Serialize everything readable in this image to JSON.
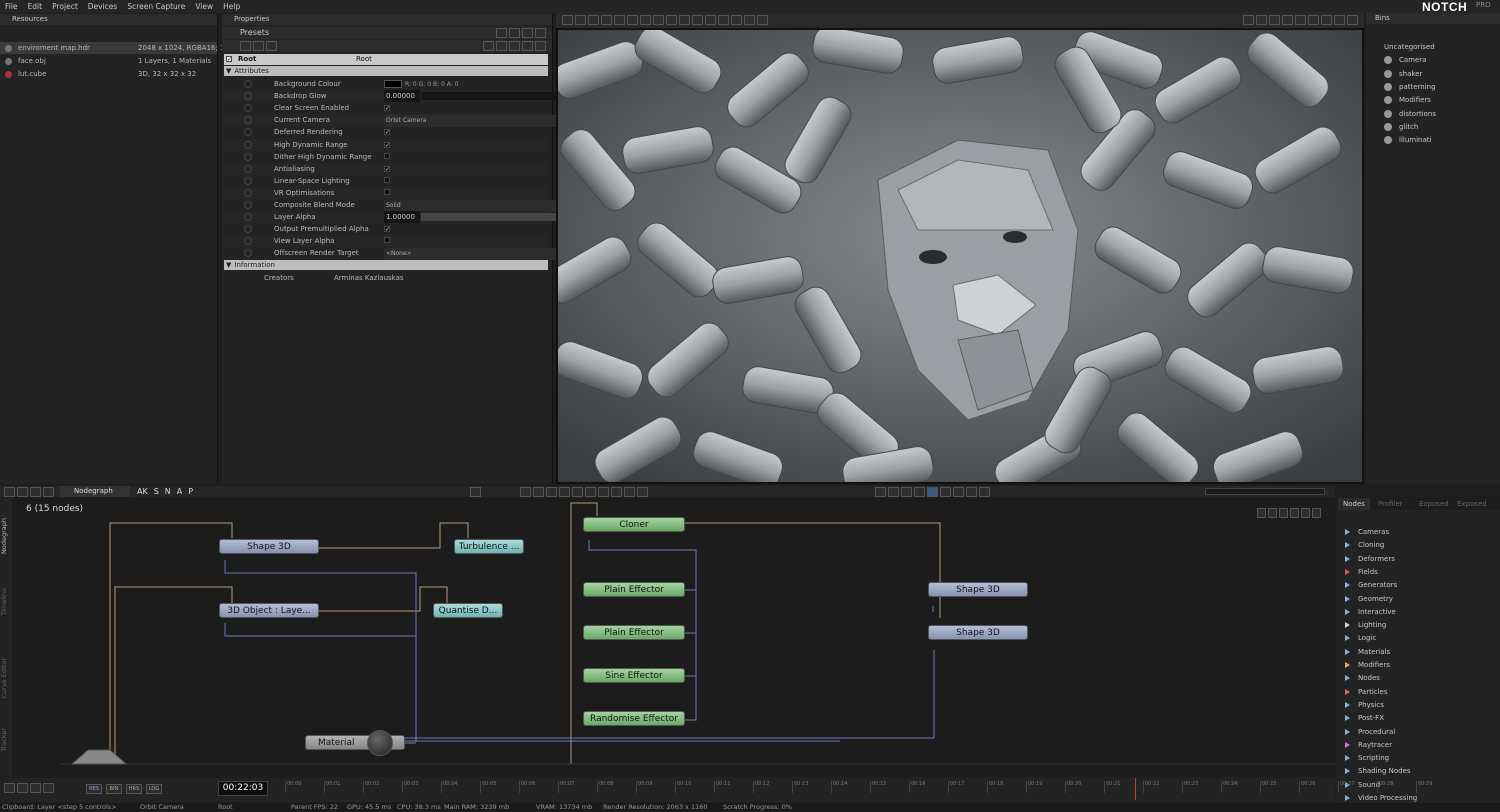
{
  "app": {
    "logo": "NOTCH",
    "edition": "PRO"
  },
  "menu": [
    "File",
    "Edit",
    "Project",
    "Devices",
    "Screen Capture",
    "View",
    "Help"
  ],
  "resources": {
    "title": "Resources",
    "items": [
      {
        "name": "enviroment map.hdr",
        "info": "2048 x 1024, RGBA16; 1"
      },
      {
        "name": "face.obj",
        "info": "1 Layers, 1 Materials"
      },
      {
        "name": "lut.cube",
        "info": "3D, 32 x 32 x 32"
      }
    ]
  },
  "properties": {
    "title": "Properties",
    "presets_label": "Presets",
    "root_label": "Root",
    "root_value": "Root",
    "section_attributes": "Attributes",
    "section_information": "Information",
    "rows": [
      {
        "label": "Background Colour",
        "value": "R: 0  G: 0  B: 0  A: 0",
        "kind": "color"
      },
      {
        "label": "Backdrop Glow",
        "value": "0.00000",
        "kind": "slider",
        "fill": 0
      },
      {
        "label": "Clear Screen Enabled",
        "value": "✓",
        "kind": "check"
      },
      {
        "label": "Current Camera",
        "value": "Orbit Camera",
        "kind": "select"
      },
      {
        "label": "Deferred Rendering",
        "value": "✓",
        "kind": "check"
      },
      {
        "label": "High Dynamic Range",
        "value": "✓",
        "kind": "check"
      },
      {
        "label": "Dither High Dynamic Range",
        "value": "",
        "kind": "check"
      },
      {
        "label": "Antialiasing",
        "value": "✓",
        "kind": "check"
      },
      {
        "label": "Linear-Space Lighting",
        "value": "",
        "kind": "check"
      },
      {
        "label": "VR Optimisations",
        "value": "",
        "kind": "check"
      },
      {
        "label": "Composite Blend Mode",
        "value": "Solid",
        "kind": "select"
      },
      {
        "label": "Layer Alpha",
        "value": "1.00000",
        "kind": "slider",
        "fill": 1
      },
      {
        "label": "Output Premultiplied Alpha",
        "value": "✓",
        "kind": "check"
      },
      {
        "label": "View Layer Alpha",
        "value": "",
        "kind": "check"
      },
      {
        "label": "Offscreen Render Target",
        "value": "<None>",
        "kind": "select"
      }
    ],
    "creators_label": "Creators",
    "creators_value": "Arminas Kazlauskas"
  },
  "bins": {
    "title": "Bins",
    "items": [
      "Uncategorised",
      "Camera",
      "shaker",
      "patterning",
      "Modifiers",
      "distortions",
      "glitch",
      "illuminati"
    ]
  },
  "nodegraph": {
    "tab": "Nodegraph",
    "tools": [
      "AK",
      "S",
      "N",
      "A",
      "P"
    ],
    "count_label": "6  (15  nodes)",
    "side_tabs": [
      "Nodegraph",
      "Timeline",
      "Curve Editor",
      "Tracker"
    ],
    "nodes": [
      "Shape  3D",
      "Turbulence  ...",
      "3D  Object  :  Laye...",
      "Quantise  D...",
      "Cloner",
      "Plain  Effector",
      "Plain  Effector",
      "Sine  Effector",
      "Randomise  Effector",
      "Shape  3D",
      "Shape  3D",
      "Material"
    ]
  },
  "nodes_panel": {
    "tabs": [
      "Nodes",
      "Profiler",
      "Exposed",
      "Exposed"
    ],
    "categories": [
      {
        "name": "Cameras",
        "color": "#8fb0d0"
      },
      {
        "name": "Cloning",
        "color": "#8fb0d0"
      },
      {
        "name": "Deformers",
        "color": "#8fb0d0"
      },
      {
        "name": "Fields",
        "color": "#d06060"
      },
      {
        "name": "Generators",
        "color": "#8fb0d0"
      },
      {
        "name": "Geometry",
        "color": "#8fb0d0"
      },
      {
        "name": "Interactive",
        "color": "#8fb0d0"
      },
      {
        "name": "Lighting",
        "color": "#d0d0d0"
      },
      {
        "name": "Logic",
        "color": "#8fb0d0"
      },
      {
        "name": "Materials",
        "color": "#8fb0d0"
      },
      {
        "name": "Modifiers",
        "color": "#d0b060"
      },
      {
        "name": "Nodes",
        "color": "#8fb0d0"
      },
      {
        "name": "Particles",
        "color": "#d07050"
      },
      {
        "name": "Physics",
        "color": "#8fb0d0"
      },
      {
        "name": "Post-FX",
        "color": "#8fb0d0"
      },
      {
        "name": "Procedural",
        "color": "#8fb0d0"
      },
      {
        "name": "Raytracer",
        "color": "#d070d0"
      },
      {
        "name": "Scripting",
        "color": "#8fb0d0"
      },
      {
        "name": "Shading Nodes",
        "color": "#8fb0d0"
      },
      {
        "name": "Sound",
        "color": "#8fb0d0"
      },
      {
        "name": "Video Processing",
        "color": "#8fb0d0"
      }
    ]
  },
  "timeline": {
    "time": "00:22:03",
    "buttons": [
      "RES",
      "BIN",
      "HRS",
      "LOG"
    ],
    "ticks": [
      "00:00",
      "00:01",
      "00:02",
      "00:03",
      "00:04",
      "00:05",
      "00:06",
      "00:07",
      "00:08",
      "00:09",
      "00:10",
      "00:11",
      "00:12",
      "00:13",
      "00:14",
      "00:15",
      "00:16",
      "00:17",
      "00:18",
      "00:19",
      "00:20",
      "00:21",
      "00:22",
      "00:23",
      "00:24",
      "00:25",
      "00:26",
      "00:27",
      "00:28",
      "00:29"
    ]
  },
  "status": {
    "clipboard": "Clipboard: Layer <step 5 controls>",
    "camera": "Orbit Camera",
    "layer": "Root",
    "fps": "Parent FPS: 22",
    "gpu": "GPU: 45.5 ms",
    "cpu": "CPU: 38.3 ms",
    "ram": "Main RAM: 3239 mb",
    "vram": "VRAM: 13734 mb",
    "resolution": "Render Resolution: 2063 x 1160",
    "scratch": "Scratch Progress: 0%"
  }
}
